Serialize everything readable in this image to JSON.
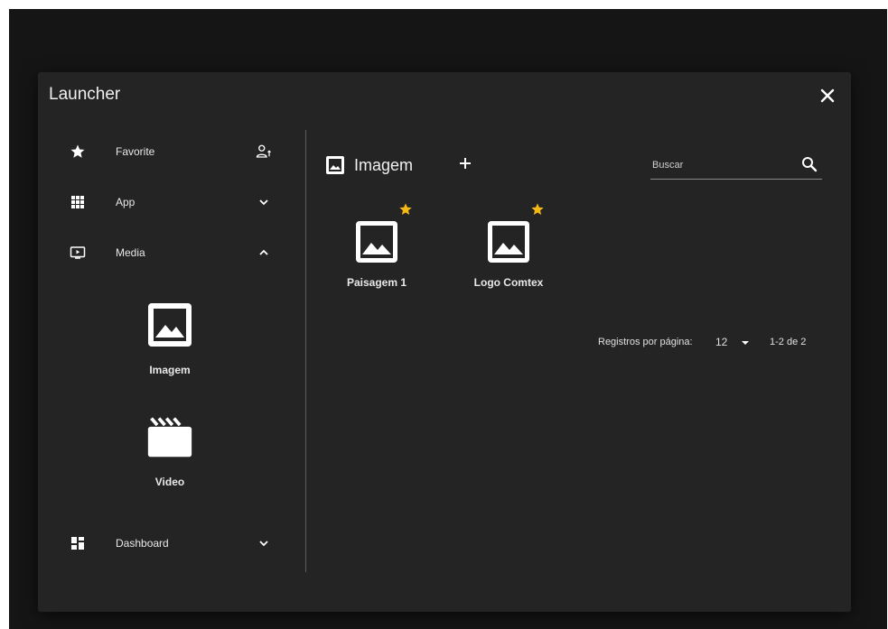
{
  "dialog": {
    "title": "Launcher"
  },
  "sidebar": {
    "items": [
      {
        "label": "Favorite",
        "icon": "star-icon",
        "trailing_icon": "person-sort-icon"
      },
      {
        "label": "App",
        "icon": "grid-icon",
        "trailing_icon": "chevron-down-icon"
      },
      {
        "label": "Media",
        "icon": "media-play-icon",
        "trailing_icon": "chevron-up-icon"
      },
      {
        "label": "Dashboard",
        "icon": "dashboard-icon",
        "trailing_icon": "chevron-down-icon"
      }
    ],
    "media_sub": [
      {
        "label": "Imagem",
        "icon": "image-icon"
      },
      {
        "label": "Video",
        "icon": "clapperboard-icon"
      }
    ]
  },
  "content": {
    "title": "Imagem",
    "search_placeholder": "Buscar",
    "cards": [
      {
        "label": "Paisagem 1",
        "favorite": true
      },
      {
        "label": "Logo Comtex",
        "favorite": true
      }
    ],
    "pagination": {
      "rows_label": "Registros por página:",
      "rows_value": "12",
      "range": "1-2 de 2"
    }
  },
  "colors": {
    "dialog_bg": "#242424",
    "backdrop": "#151515",
    "star_accent": "#f5b916",
    "icon": "#ffffff"
  }
}
